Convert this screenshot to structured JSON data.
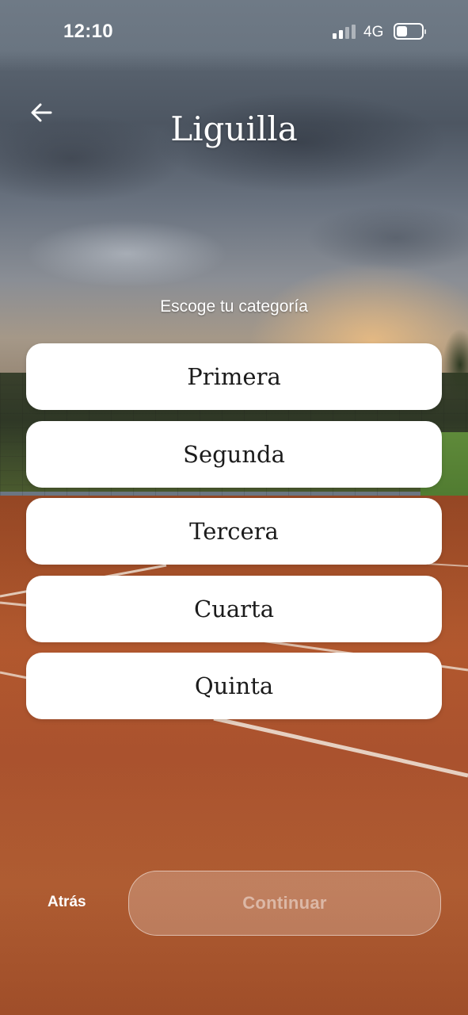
{
  "status_bar": {
    "time": "12:10",
    "network": "4G",
    "signal_icon": "cellular-signal-icon",
    "battery_icon": "battery-icon"
  },
  "header": {
    "title": "Liguilla",
    "back_icon": "arrow-left-icon"
  },
  "prompt": "Escoge tu categoría",
  "categories": [
    {
      "label": "Primera"
    },
    {
      "label": "Segunda"
    },
    {
      "label": "Tercera"
    },
    {
      "label": "Cuarta"
    },
    {
      "label": "Quinta"
    }
  ],
  "footer": {
    "back_label": "Atrás",
    "continue_label": "Continuar",
    "continue_enabled": false
  }
}
